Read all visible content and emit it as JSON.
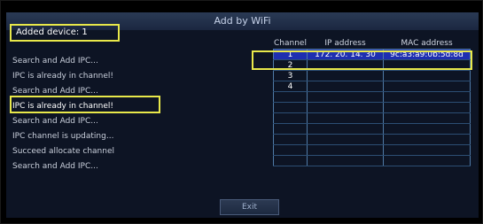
{
  "window": {
    "title": "Add by WiFi"
  },
  "added_device": {
    "label": "Added device: 1"
  },
  "log": [
    "Search and Add IPC...",
    "IPC is already in channel!",
    "Search and Add IPC...",
    "IPC is already in channel!",
    "Search and Add IPC...",
    "IPC channel is updating...",
    "Succeed allocate channel",
    "Search and Add IPC..."
  ],
  "table": {
    "headers": [
      "Channel",
      "IP address",
      "MAC address"
    ],
    "rows": [
      [
        "1",
        "172. 20. 14. 30",
        "9c:a3:a9:0b:5d:8d"
      ],
      [
        "2",
        "",
        ""
      ],
      [
        "3",
        "",
        ""
      ],
      [
        "4",
        "",
        ""
      ],
      [
        "",
        "",
        ""
      ],
      [
        "",
        "",
        ""
      ],
      [
        "",
        "",
        ""
      ],
      [
        "",
        "",
        ""
      ],
      [
        "",
        "",
        ""
      ],
      [
        "",
        "",
        ""
      ],
      [
        "",
        "",
        ""
      ]
    ]
  },
  "buttons": {
    "exit": "Exit"
  },
  "colors": {
    "highlight_border": "#e8e84a",
    "selected_row": "#1e2fb0",
    "grid": "#4f7aa6"
  }
}
